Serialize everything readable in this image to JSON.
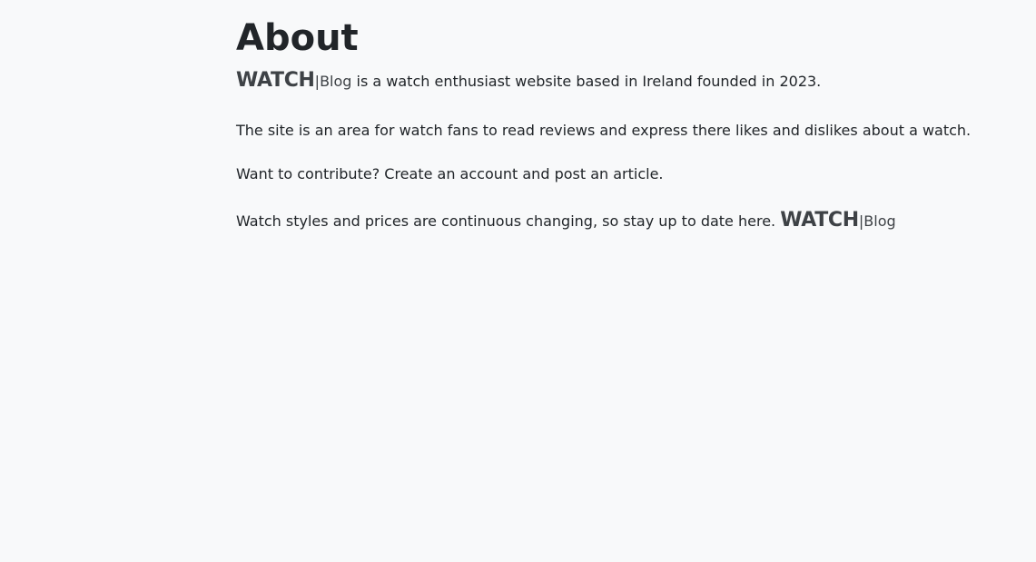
{
  "page": {
    "title": "About"
  },
  "brand": {
    "big": "WATCH",
    "small": "|Blog"
  },
  "paragraphs": {
    "intro_rest": " is a watch enthusiast website based in Ireland founded in 2023.",
    "site_area": "The site is an area for watch fans to read reviews and express there likes and dislikes about a watch.",
    "contribute": "Want to contribute? Create an account and post an article.",
    "styles_prefix": "Watch styles and prices are continuous changing, so stay up to date here. "
  }
}
